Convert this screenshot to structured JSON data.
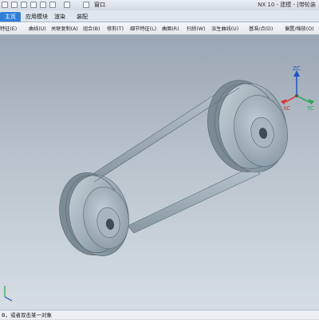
{
  "title_bar": {
    "window_menu": "窗口",
    "app_title": "NX 10 - 建模 - [带轮装"
  },
  "tabs": [
    {
      "label": "主页",
      "active": true
    },
    {
      "label": "应用模块"
    },
    {
      "label": "渲染"
    },
    {
      "label": "装配"
    }
  ],
  "menus": [
    "特征(E)",
    "曲线(U)",
    "关联复制(A)",
    "组合(B)",
    "修剪(T)",
    "细节特征(L)",
    "曲面(R)",
    "扫掠(W)",
    "派生曲线(U)",
    "基准/点(D)",
    "偏置/缩放(O)"
  ],
  "axes": {
    "zc": "ZC",
    "yc": "YC",
    "xc": "XC",
    "color_z": "#1d55c6",
    "color_y": "#2aa64d",
    "color_x": "#d7342c"
  },
  "status_bar": {
    "message": "B，或者双击某一对象"
  }
}
